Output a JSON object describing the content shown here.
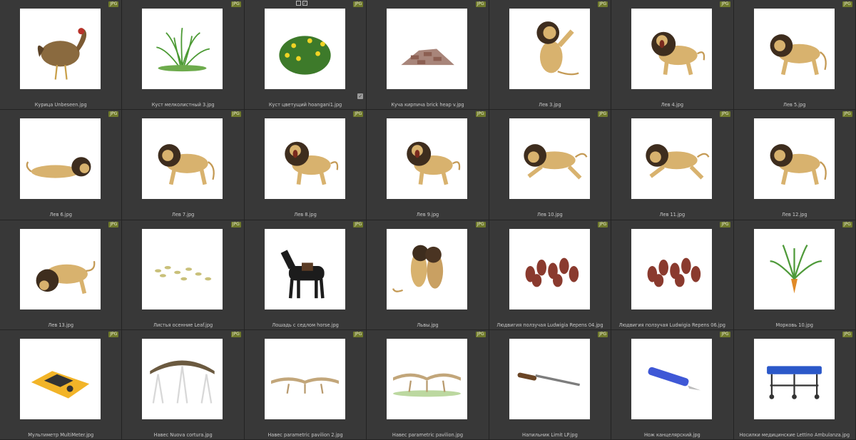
{
  "badge_text": "JPG",
  "selected_cell_controls": {
    "frame_icon": "square-frame-icon",
    "edit_icon": "pencil-icon",
    "check_icon": "checkmark-icon"
  },
  "items": [
    {
      "label": "Курица Unbeseen.jpg",
      "icon": "chicken"
    },
    {
      "label": "Куст мелколистный 3.jpg",
      "icon": "grass"
    },
    {
      "label": "Куст цветущий hoangani1.jpg",
      "icon": "flowerbush"
    },
    {
      "label": "Куча кирпича brick heap v.jpg",
      "icon": "bricks"
    },
    {
      "label": "Лев 3.jpg",
      "icon": "lion-stand"
    },
    {
      "label": "Лев 4.jpg",
      "icon": "lion-roar"
    },
    {
      "label": "Лев 5.jpg",
      "icon": "lion-walk"
    },
    {
      "label": "Лев 6.jpg",
      "icon": "lion-lying"
    },
    {
      "label": "Лев 7.jpg",
      "icon": "lion-walk"
    },
    {
      "label": "Лев 8.jpg",
      "icon": "lion-roar"
    },
    {
      "label": "Лев 9.jpg",
      "icon": "lion-roar"
    },
    {
      "label": "Лев 10.jpg",
      "icon": "lion-run"
    },
    {
      "label": "Лев 11.jpg",
      "icon": "lion-run"
    },
    {
      "label": "Лев 12.jpg",
      "icon": "lion-walk"
    },
    {
      "label": "Лев 13.jpg",
      "icon": "lion-sniff"
    },
    {
      "label": "Листья осенние Leaf.jpg",
      "icon": "leaves"
    },
    {
      "label": "Лошадь с седлом horse.jpg",
      "icon": "horse"
    },
    {
      "label": "Львы.jpg",
      "icon": "lions-fight"
    },
    {
      "label": "Людвигия ползучая Ludwigia Repens 04.jpg",
      "icon": "redplant"
    },
    {
      "label": "Людвигия ползучая Ludwigia Repens 06.jpg",
      "icon": "redplant"
    },
    {
      "label": "Морковь 10.jpg",
      "icon": "carrot"
    },
    {
      "label": "Мультиметр MultiMeter.jpg",
      "icon": "multimeter"
    },
    {
      "label": "Навес Nuova cortura.jpg",
      "icon": "pavilion1"
    },
    {
      "label": "Навес parametric pavilion 2.jpg",
      "icon": "pavilion2"
    },
    {
      "label": "Навес parametric pavilion.jpg",
      "icon": "pavilion3"
    },
    {
      "label": "Напильник Limit LP.jpg",
      "icon": "file-tool"
    },
    {
      "label": "Нож канцелярский.jpg",
      "icon": "knife"
    },
    {
      "label": "Носилки медицинские Lettino Ambulanza.jpg",
      "icon": "stretcher"
    }
  ]
}
